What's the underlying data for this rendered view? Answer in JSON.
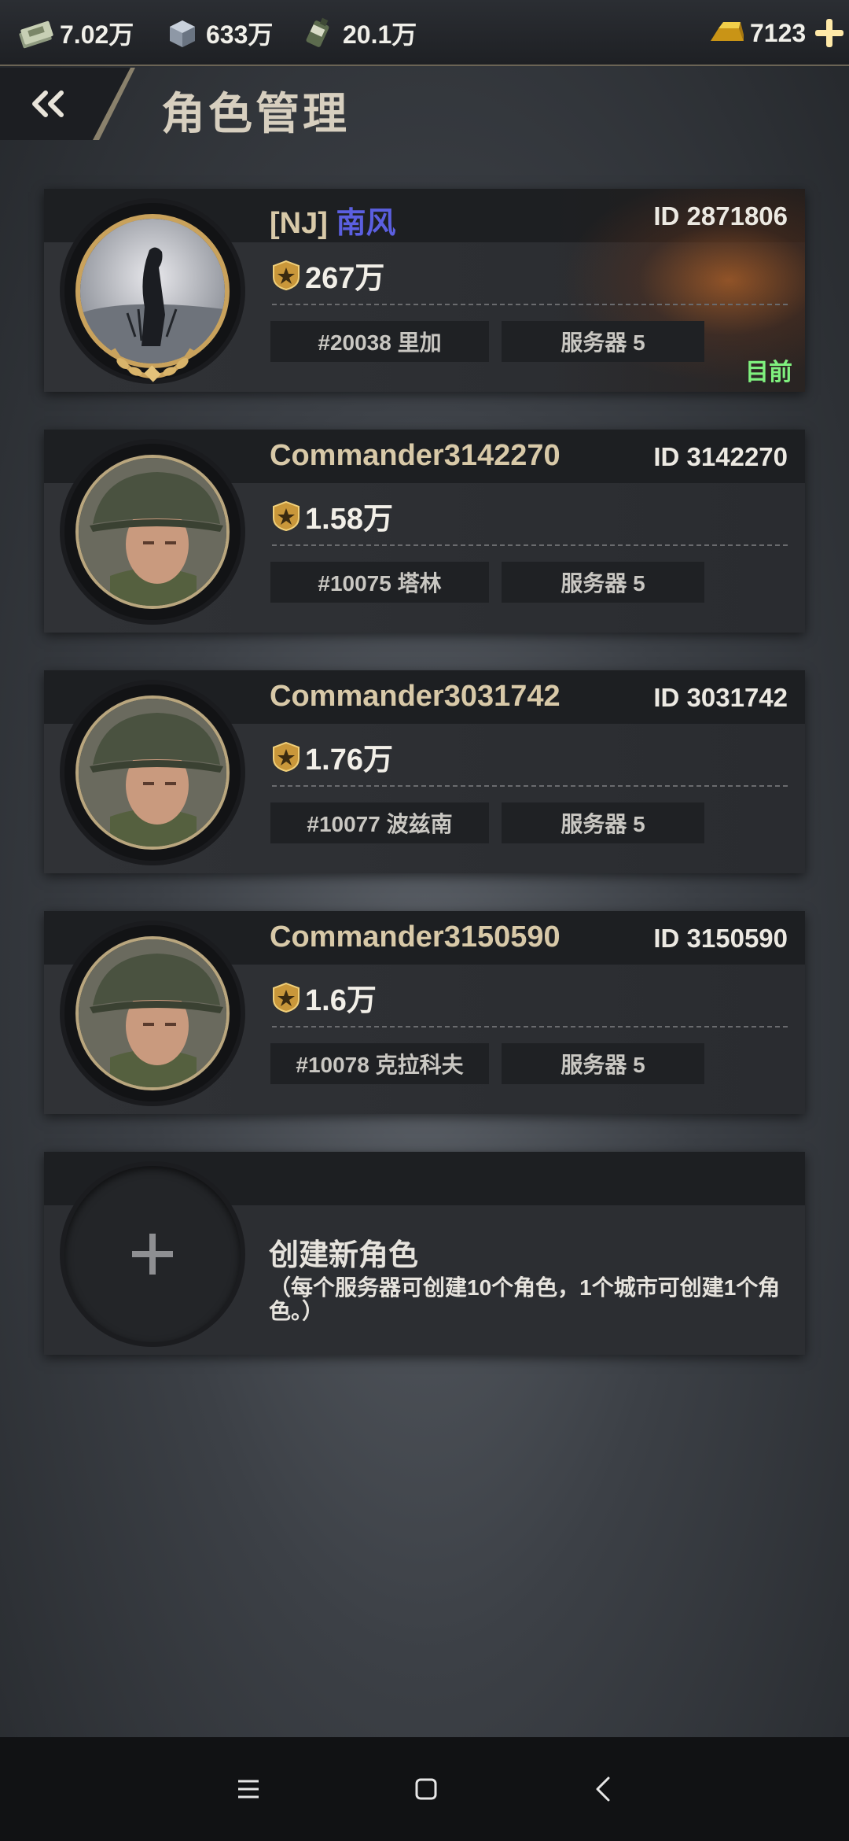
{
  "resources": [
    {
      "icon": "cash-icon",
      "value": "7.02万"
    },
    {
      "icon": "steel-icon",
      "value": "633万"
    },
    {
      "icon": "oil-icon",
      "value": "20.1万"
    }
  ],
  "gold": {
    "icon": "gold-bar-icon",
    "value": "7123"
  },
  "header": {
    "title": "角色管理"
  },
  "characters": [
    {
      "tag": "[NJ]",
      "name": "南风",
      "id": "ID 2871806",
      "power": "267万",
      "city": "#20038 里加",
      "server": "服务器 5",
      "current": "目前"
    },
    {
      "name": "Commander3142270",
      "id": "ID 3142270",
      "power": "1.58万",
      "city": "#10075 塔林",
      "server": "服务器 5"
    },
    {
      "name": "Commander3031742",
      "id": "ID 3031742",
      "power": "1.76万",
      "city": "#10077 波兹南",
      "server": "服务器 5"
    },
    {
      "name": "Commander3150590",
      "id": "ID 3150590",
      "power": "1.6万",
      "city": "#10078 克拉科夫",
      "server": "服务器 5"
    }
  ],
  "create": {
    "title": "创建新角色",
    "description": "（每个服务器可创建10个角色，1个城市可创建1个角色。）"
  },
  "colors": {
    "current": "#7ff07e",
    "alliance": "#5b5fe0",
    "name": "#d8c9a8"
  }
}
